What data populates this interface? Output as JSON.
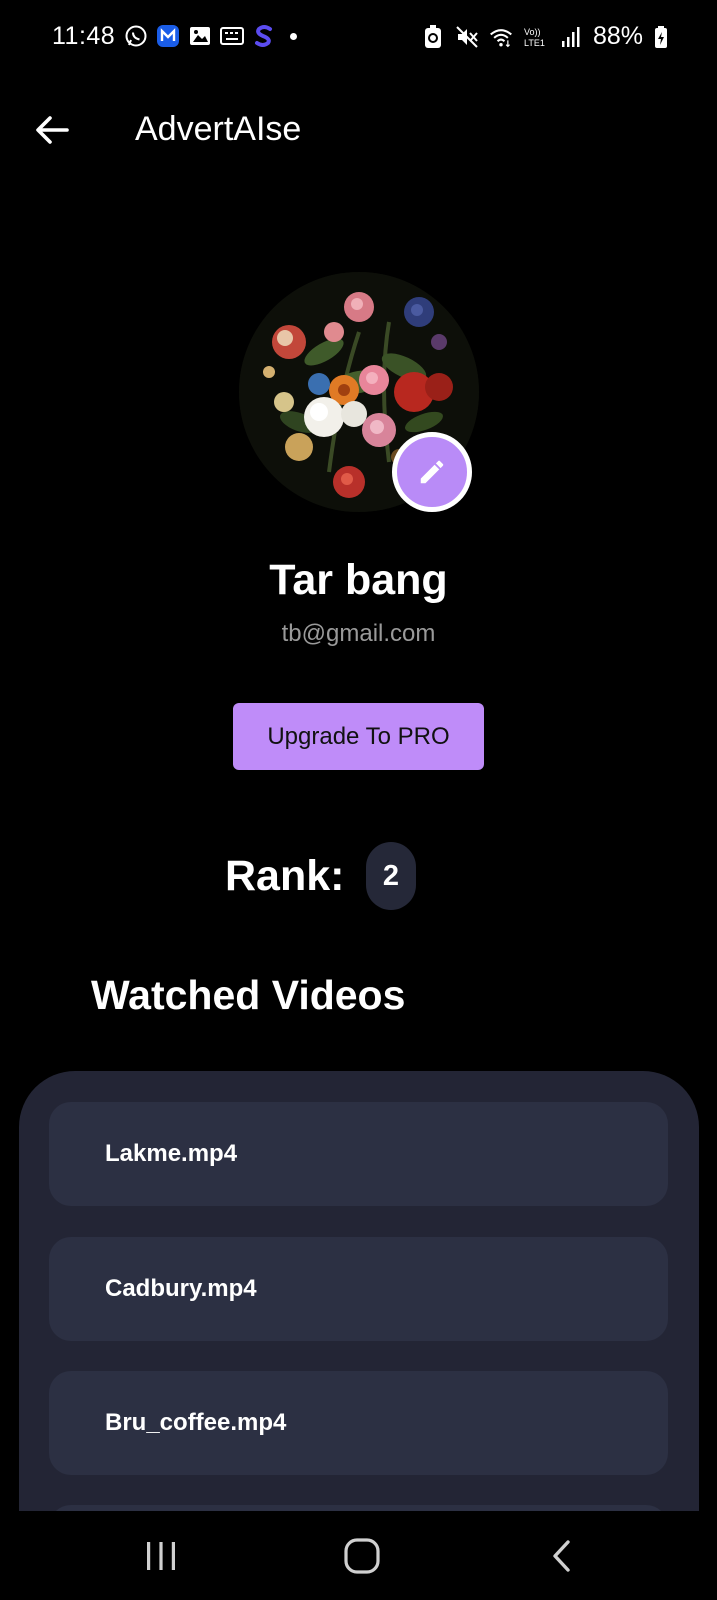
{
  "status_bar": {
    "time": "11:48",
    "battery": "88%",
    "icons_left": [
      "whatsapp-icon",
      "m-app-icon",
      "gallery-icon",
      "keyboard-icon",
      "s-app-icon",
      "dot-icon"
    ],
    "icons_right": [
      "battery-saver-icon",
      "mute-icon",
      "wifi-icon",
      "volte-icon",
      "signal-icon",
      "battery-icon"
    ],
    "volte_label": "Vo)) LTE1"
  },
  "app_bar": {
    "title": "AdvertAIse",
    "back_icon": "arrow-left-icon"
  },
  "profile": {
    "name": "Tar bang",
    "email": "tb@gmail.com",
    "edit_icon": "pencil-icon"
  },
  "upgrade_button": {
    "label": "Upgrade To PRO"
  },
  "rank": {
    "label": "Rank:",
    "value": "2"
  },
  "watched_videos": {
    "title": "Watched Videos",
    "items": [
      {
        "name": "Lakme.mp4"
      },
      {
        "name": "Cadbury.mp4"
      },
      {
        "name": "Bru_coffee.mp4"
      }
    ]
  },
  "nav_bar": {
    "buttons": [
      "recents-icon",
      "home-icon",
      "back-chevron-icon"
    ]
  },
  "colors": {
    "background": "#000000",
    "accent": "#bf8cf9",
    "panel": "#232535",
    "item": "#2c3043",
    "email_text": "#9a9a9a"
  }
}
